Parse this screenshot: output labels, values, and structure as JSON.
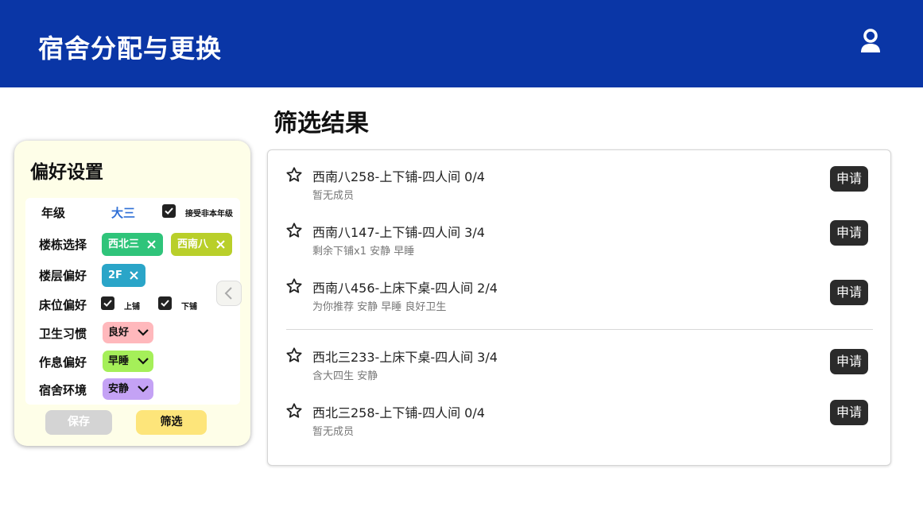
{
  "header": {
    "title": "宿舍分配与更换",
    "user_icon": "user-icon"
  },
  "preferences": {
    "title": "偏好设置",
    "grade": {
      "label": "年级",
      "value": "大三",
      "accept_other": {
        "label": "接受非本年级",
        "checked": true
      }
    },
    "building": {
      "label": "楼栋选择",
      "chips": [
        {
          "text": "西北三",
          "color": "#2fc47a"
        },
        {
          "text": "西南八",
          "color": "#b9cf2a"
        }
      ]
    },
    "floor": {
      "label": "楼层偏好",
      "chips": [
        {
          "text": "2F",
          "color": "#2aa5c8"
        }
      ]
    },
    "bed": {
      "label": "床位偏好",
      "options": [
        {
          "text": "上铺",
          "checked": true
        },
        {
          "text": "下铺",
          "checked": true
        }
      ]
    },
    "hygiene": {
      "label": "卫生习惯",
      "value": "良好",
      "color": "#ffb8bc"
    },
    "schedule": {
      "label": "作息偏好",
      "value": "早睡",
      "color": "#a5ef59"
    },
    "environment": {
      "label": "宿舍环境",
      "value": "安静",
      "color": "#c4a2f5"
    },
    "save_label": "保存",
    "filter_label": "筛选"
  },
  "results": {
    "title": "筛选结果",
    "apply_label": "申请",
    "items": [
      {
        "name": "西南八258-上下铺-四人间 0/4",
        "sub": "暂无成员"
      },
      {
        "name": "西南八147-上下铺-四人间 3/4",
        "sub": "剩余下铺x1 安静 早睡"
      },
      {
        "name": "西南八456-上床下桌-四人间 2/4",
        "sub": "为你推荐 安静 早睡 良好卫生"
      },
      {
        "name": "西北三233-上床下桌-四人间 3/4",
        "sub": "含大四生 安静"
      },
      {
        "name": "西北三258-上下铺-四人间 0/4",
        "sub": "暂无成员"
      }
    ]
  },
  "colors": {
    "header_bg": "#0a36a6",
    "grade_accent": "#2f6fd6",
    "filter_button": "#fde57a",
    "save_button": "#d4d4d4"
  }
}
